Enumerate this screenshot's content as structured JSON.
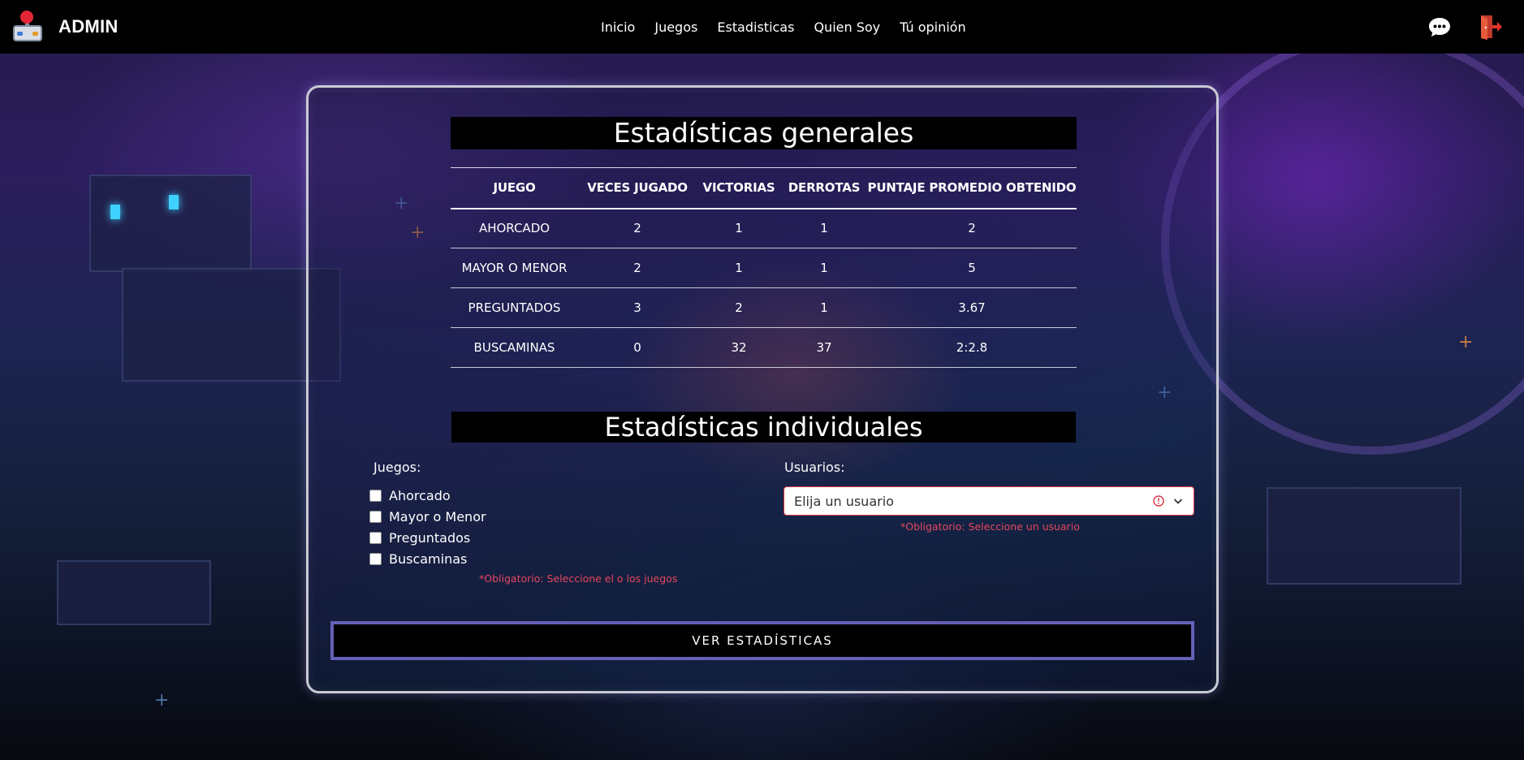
{
  "navbar": {
    "brand": "ADMIN",
    "links": [
      "Inicio",
      "Juegos",
      "Estadisticas",
      "Quien Soy",
      "Tú opinión"
    ],
    "icons": {
      "chat": "chat-bubble-icon",
      "logout": "logout-door-icon"
    }
  },
  "general": {
    "title": "Estadísticas generales",
    "headers": [
      "JUEGO",
      "VECES JUGADO",
      "VICTORIAS",
      "DERROTAS",
      "PUNTAJE PROMEDIO OBTENIDO"
    ],
    "rows": [
      [
        "AHORCADO",
        "2",
        "1",
        "1",
        "2"
      ],
      [
        "MAYOR O MENOR",
        "2",
        "1",
        "1",
        "5"
      ],
      [
        "PREGUNTADOS",
        "3",
        "2",
        "1",
        "3.67"
      ],
      [
        "BUSCAMINAS",
        "0",
        "32",
        "37",
        "2:2.8"
      ]
    ]
  },
  "individual": {
    "title": "Estadísticas individuales",
    "games_label": "Juegos:",
    "games": [
      "Ahorcado",
      "Mayor o Menor",
      "Preguntados",
      "Buscaminas"
    ],
    "games_error": "*Obligatorio: Seleccione el o los juegos",
    "users_label": "Usuarios:",
    "users_placeholder": "Elija un usuario",
    "users_error": "*Obligatorio: Seleccione un usuario",
    "submit": "VER ESTADÍSTICAS"
  },
  "colors": {
    "error": "#e8475e",
    "button_border": "#6560b8",
    "navbar": "#000000"
  }
}
